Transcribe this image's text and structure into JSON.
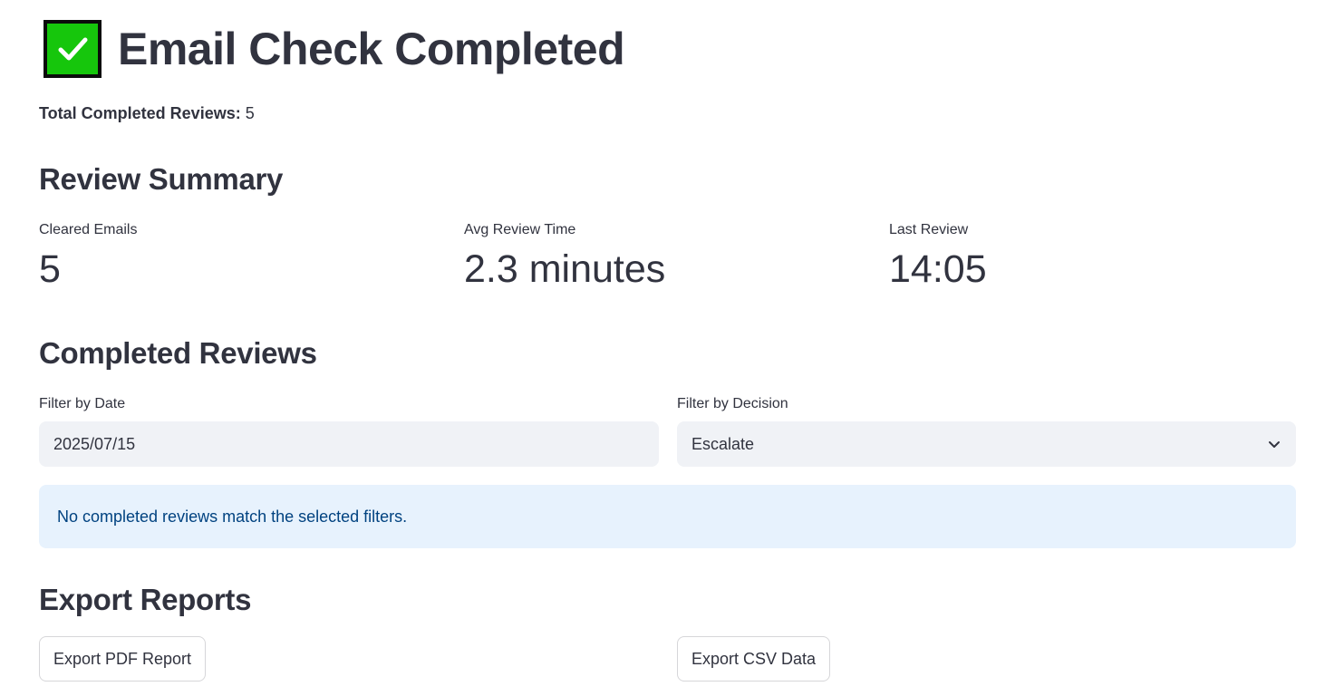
{
  "header": {
    "title": "Email Check Completed",
    "icon": "check-mark-button-icon",
    "icon_color": "#16c60c"
  },
  "totals": {
    "label": "Total Completed Reviews:",
    "value": "5"
  },
  "summary": {
    "title": "Review Summary",
    "metrics": [
      {
        "label": "Cleared Emails",
        "value": "5"
      },
      {
        "label": "Avg Review Time",
        "value": "2.3 minutes"
      },
      {
        "label": "Last Review",
        "value": "14:05"
      }
    ]
  },
  "completed": {
    "title": "Completed Reviews",
    "date_filter": {
      "label": "Filter by Date",
      "value": "2025/07/15"
    },
    "decision_filter": {
      "label": "Filter by Decision",
      "value": "Escalate"
    },
    "info_message": "No completed reviews match the selected filters.",
    "info_color": "#004280"
  },
  "export": {
    "title": "Export Reports",
    "pdf_label": "Export PDF Report",
    "csv_label": "Export CSV Data"
  }
}
